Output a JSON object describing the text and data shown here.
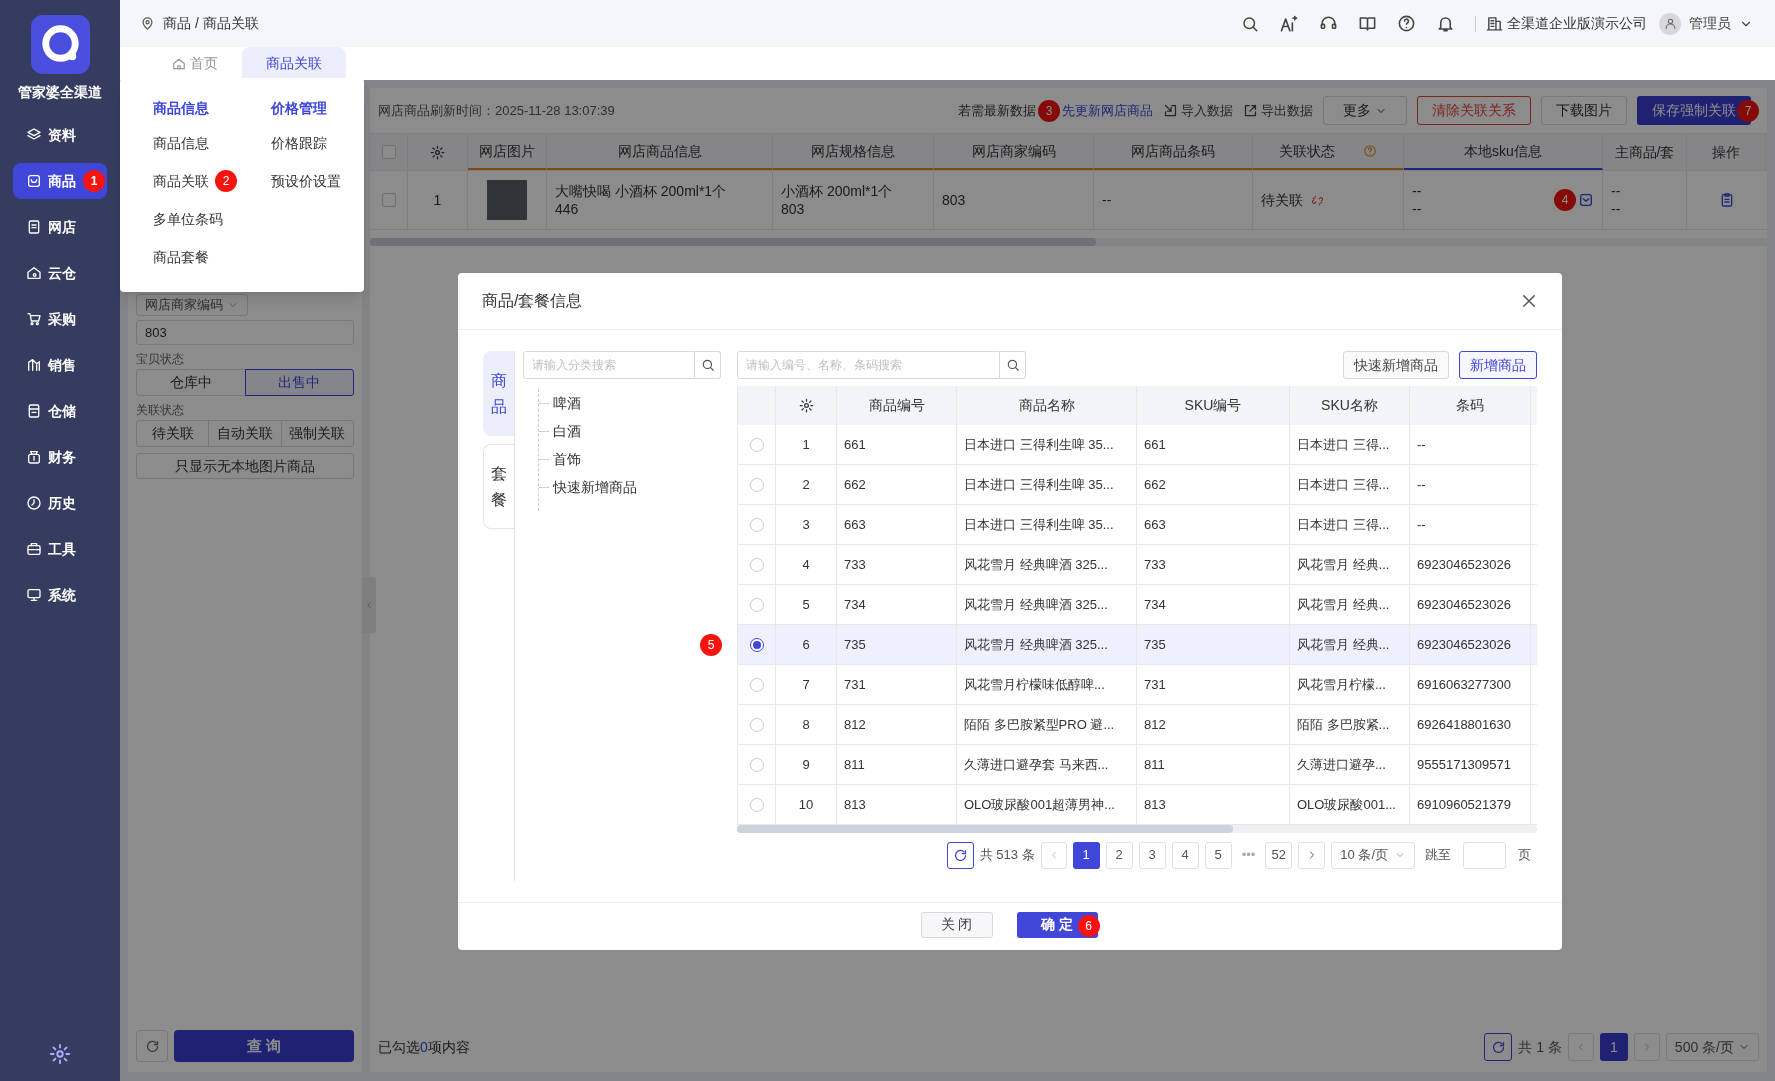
{
  "sidebar": {
    "brand": "管家婆全渠道",
    "items": [
      {
        "label": "资料",
        "selected": false
      },
      {
        "label": "商品",
        "selected": true,
        "badge": "1"
      },
      {
        "label": "网店",
        "selected": false
      },
      {
        "label": "云仓",
        "selected": false
      },
      {
        "label": "采购",
        "selected": false
      },
      {
        "label": "销售",
        "selected": false
      },
      {
        "label": "仓储",
        "selected": false
      },
      {
        "label": "财务",
        "selected": false
      },
      {
        "label": "历史",
        "selected": false
      },
      {
        "label": "工具",
        "selected": false
      },
      {
        "label": "系统",
        "selected": false
      }
    ]
  },
  "breadcrumb": "商品 / 商品关联",
  "header": {
    "company": "全渠道企业版演示公司",
    "user": "管理员"
  },
  "tabs": [
    {
      "label": "首页",
      "selected": false
    },
    {
      "label": "商品关联",
      "selected": true
    }
  ],
  "menu": {
    "columns": [
      {
        "title": "商品信息",
        "items": [
          {
            "label": "商品信息"
          },
          {
            "label": "商品关联",
            "badge": "2"
          },
          {
            "label": "多单位条码"
          },
          {
            "label": "商品套餐"
          }
        ]
      },
      {
        "title": "价格管理",
        "items": [
          {
            "label": "价格跟踪"
          },
          {
            "label": "预设价设置"
          }
        ]
      }
    ]
  },
  "filters": {
    "field_select": "网店商家编码",
    "field_value": "803",
    "groups": [
      {
        "label": "宝贝状态",
        "options": [
          {
            "label": "仓库中",
            "selected": false
          },
          {
            "label": "出售中",
            "selected": true
          }
        ]
      },
      {
        "label": "关联状态",
        "options": [
          {
            "label": "待关联",
            "selected": false
          },
          {
            "label": "自动关联",
            "selected": false
          },
          {
            "label": "强制关联",
            "selected": false
          }
        ]
      }
    ],
    "toggle_button": "只显示无本地图片商品",
    "search_button": "查 询"
  },
  "main": {
    "refresh_time": "网店商品刷新时间：2025-11-28 13:07:39",
    "hint": "若需最新数据",
    "hint_badge": "3",
    "update_link": "先更新网店商品",
    "actions": [
      {
        "kind": "import",
        "label": "导入数据"
      },
      {
        "kind": "export",
        "label": "导出数据"
      },
      {
        "kind": "dropdown",
        "label": "更多"
      },
      {
        "kind": "danger",
        "label": "清除关联关系"
      },
      {
        "kind": "default",
        "label": "下载图片"
      },
      {
        "kind": "primary",
        "label": "保存强制关联",
        "badge": "7"
      }
    ],
    "table": {
      "header_checked": false,
      "columns": [
        "网店图片",
        "网店商品信息",
        "网店规格信息",
        "网店商家编码",
        "网店商品条码",
        "关联状态",
        "本地sku信息",
        "主商品/套",
        "操作"
      ],
      "rows": [
        {
          "checked": false,
          "index": "1",
          "product_title": "大嘴快喝 小酒杯 200ml*1个",
          "product_id": "446",
          "spec_title": "小酒杯 200ml*1个",
          "spec_id": "803",
          "merchant_code": "803",
          "barcode": "--",
          "link_status": "待关联",
          "local_sku": [
            "--",
            "--"
          ],
          "local_sku_badge": "4",
          "main_product": [
            "--",
            "--"
          ]
        }
      ]
    },
    "selection": {
      "prefix": "已勾选",
      "count": "0",
      "suffix": "项内容"
    },
    "pagination": {
      "total": "共 1 条",
      "pages": [
        {
          "label": "1",
          "selected": true
        }
      ],
      "page_size": "500 条/页"
    }
  },
  "dialog": {
    "title": "商品/套餐信息",
    "side_tabs": [
      {
        "label": "商品",
        "selected": true
      },
      {
        "label": "套餐",
        "selected": false
      }
    ],
    "category_search": {
      "placeholder": "请输入分类搜索"
    },
    "categories": [
      {
        "label": "啤酒"
      },
      {
        "label": "白酒"
      },
      {
        "label": "首饰"
      },
      {
        "label": "快速新增商品"
      }
    ],
    "search": {
      "placeholder": "请输入编号、名称、条码搜索"
    },
    "buttons": [
      {
        "kind": "default",
        "label": "快速新增商品"
      },
      {
        "kind": "outline",
        "label": "新增商品"
      }
    ],
    "table": {
      "columns": [
        "商品编号",
        "商品名称",
        "SKU编号",
        "SKU名称",
        "条码"
      ],
      "rows": [
        {
          "selected": false,
          "index": "1",
          "code": "661",
          "name": "日本进口 三得利生啤 35...",
          "sku_code": "661",
          "sku_name": "日本进口 三得...",
          "barcode": "--"
        },
        {
          "selected": false,
          "index": "2",
          "code": "662",
          "name": "日本进口 三得利生啤 35...",
          "sku_code": "662",
          "sku_name": "日本进口 三得...",
          "barcode": "--"
        },
        {
          "selected": false,
          "index": "3",
          "code": "663",
          "name": "日本进口 三得利生啤 35...",
          "sku_code": "663",
          "sku_name": "日本进口 三得...",
          "barcode": "--"
        },
        {
          "selected": false,
          "index": "4",
          "code": "733",
          "name": "风花雪月 经典啤酒 325...",
          "sku_code": "733",
          "sku_name": "风花雪月 经典...",
          "barcode": "6923046523026"
        },
        {
          "selected": false,
          "index": "5",
          "code": "734",
          "name": "风花雪月 经典啤酒 325...",
          "sku_code": "734",
          "sku_name": "风花雪月 经典...",
          "barcode": "6923046523026"
        },
        {
          "selected": true,
          "badge": "5",
          "index": "6",
          "code": "735",
          "name": "风花雪月 经典啤酒 325...",
          "sku_code": "735",
          "sku_name": "风花雪月 经典...",
          "barcode": "6923046523026"
        },
        {
          "selected": false,
          "index": "7",
          "code": "731",
          "name": "风花雪月柠檬味低醇啤...",
          "sku_code": "731",
          "sku_name": "风花雪月柠檬...",
          "barcode": "6916063277300"
        },
        {
          "selected": false,
          "index": "8",
          "code": "812",
          "name": "陌陌 多巴胺紧型PRO 避...",
          "sku_code": "812",
          "sku_name": "陌陌 多巴胺紧...",
          "barcode": "6926418801630"
        },
        {
          "selected": false,
          "index": "9",
          "code": "811",
          "name": "久薄进口避孕套 马来西...",
          "sku_code": "811",
          "sku_name": "久薄进口避孕...",
          "barcode": "9555171309571"
        },
        {
          "selected": false,
          "index": "10",
          "code": "813",
          "name": "OLO玻尿酸001超薄男神...",
          "sku_code": "813",
          "sku_name": "OLO玻尿酸001...",
          "barcode": "6910960521379"
        }
      ]
    },
    "pagination": {
      "total": "共 513 条",
      "pages": [
        {
          "label": "1",
          "selected": true
        },
        {
          "label": "2",
          "selected": false
        },
        {
          "label": "3",
          "selected": false
        },
        {
          "label": "4",
          "selected": false
        },
        {
          "label": "5",
          "selected": false
        }
      ],
      "ellipsis": "•••",
      "last_page": "52",
      "page_size": "10 条/页",
      "jump_label": "跳至",
      "page_unit": "页"
    },
    "footer_buttons": [
      {
        "kind": "default",
        "label": "关 闭"
      },
      {
        "kind": "primary",
        "label": "确 定",
        "badge": "6"
      }
    ]
  }
}
